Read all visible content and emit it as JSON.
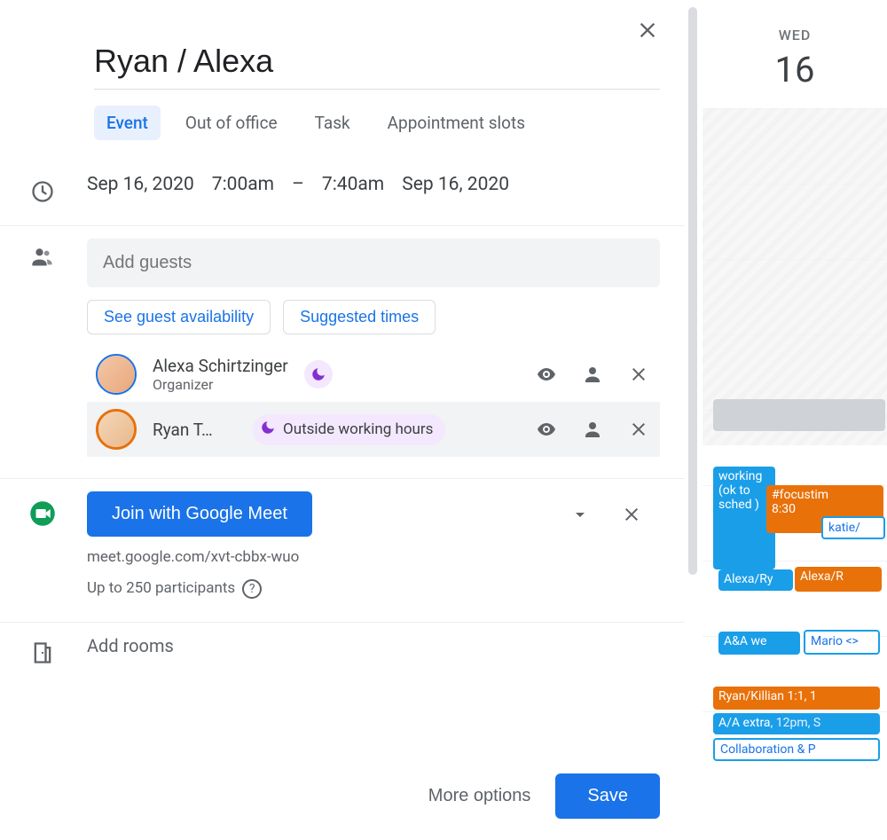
{
  "title": "Ryan / Alexa",
  "tabs": [
    {
      "label": "Event",
      "active": true
    },
    {
      "label": "Out of office",
      "active": false
    },
    {
      "label": "Task",
      "active": false
    },
    {
      "label": "Appointment slots",
      "active": false
    }
  ],
  "time": {
    "start_date": "Sep 16, 2020",
    "start_time": "7:00am",
    "dash": "–",
    "end_time": "7:40am",
    "end_date": "Sep 16, 2020"
  },
  "guests": {
    "placeholder": "Add guests",
    "availability_label": "See guest availability",
    "suggested_label": "Suggested times",
    "list": [
      {
        "name": "Alexa Schirtzinger",
        "sub": "Organizer",
        "status_chip": "",
        "moon": true,
        "highlight": false
      },
      {
        "name": "Ryan T…",
        "sub": "",
        "status_chip": "Outside working hours",
        "moon": true,
        "highlight": true
      }
    ]
  },
  "meet": {
    "button": "Join with Google Meet",
    "link": "meet.google.com/xvt-cbbx-wuo",
    "participants": "Up to 250 participants"
  },
  "rooms": {
    "placeholder": "Add rooms"
  },
  "footer": {
    "more": "More options",
    "save": "Save"
  },
  "calendar": {
    "day_name": "WED",
    "day_number": "16",
    "events": {
      "working": "working\n(ok to\nsched\n)",
      "focustime": "#focustim",
      "focustime_time": "8:30",
      "katie": "katie/",
      "alexa_r_blue": "Alexa/Ry",
      "alexa_r_orange": "Alexa/R",
      "aa_we": "A&A we",
      "mario": "Mario <>",
      "ryan_killian": "Ryan/Killian 1:1, 1",
      "aa_extra": "A/A extra",
      "aa_extra_time": ", 12pm, S",
      "collab": "Collaboration & P"
    }
  }
}
